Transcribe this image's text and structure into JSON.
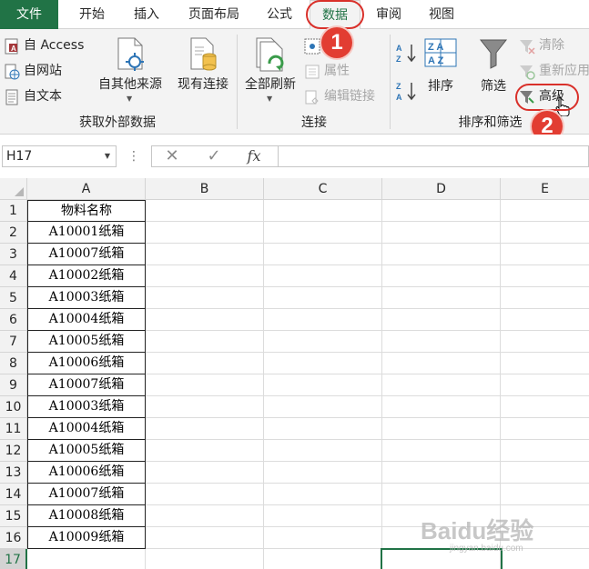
{
  "tabs": [
    "文件",
    "开始",
    "插入",
    "页面布局",
    "公式",
    "数据",
    "审阅",
    "视图"
  ],
  "active_tab": "数据",
  "ribbon": {
    "get_external": {
      "access": "自 Access",
      "web": "自网站",
      "text": "自文本",
      "other_sources": "自其他来源",
      "existing_conn": "现有连接",
      "group_label": "获取外部数据"
    },
    "connections": {
      "refresh_all": "全部刷新",
      "properties": "属性",
      "edit_links": "编辑链接",
      "group_label": "连接"
    },
    "sort_filter": {
      "sort_az": "A↓Z",
      "sort_za": "Z↓A",
      "sort": "排序",
      "filter": "筛选",
      "clear": "清除",
      "reapply": "重新应用",
      "advanced": "高级",
      "group_label": "排序和筛选"
    }
  },
  "callouts": [
    "1",
    "2"
  ],
  "formula_bar": {
    "name_box": "H17",
    "cancel": "✕",
    "enter": "✓",
    "fx": "fx",
    "value": ""
  },
  "columns": [
    "A",
    "B",
    "C",
    "D",
    "E"
  ],
  "rows": [
    "1",
    "2",
    "3",
    "4",
    "5",
    "6",
    "7",
    "8",
    "9",
    "10",
    "11",
    "12",
    "13",
    "14",
    "15",
    "16",
    "17"
  ],
  "cellsA": [
    "物料名称",
    "A10001纸箱",
    "A10007纸箱",
    "A10002纸箱",
    "A10003纸箱",
    "A10004纸箱",
    "A10005纸箱",
    "A10006纸箱",
    "A10007纸箱",
    "A10003纸箱",
    "A10004纸箱",
    "A10005纸箱",
    "A10006纸箱",
    "A10007纸箱",
    "A10008纸箱",
    "A10009纸箱",
    ""
  ],
  "watermark": "Baidu经验",
  "watermark_url": "jingyan.baidu.com",
  "colors": {
    "excel_green": "#217346",
    "callout_red": "#e23d32",
    "ribbon_bg": "#f3f3f3"
  }
}
